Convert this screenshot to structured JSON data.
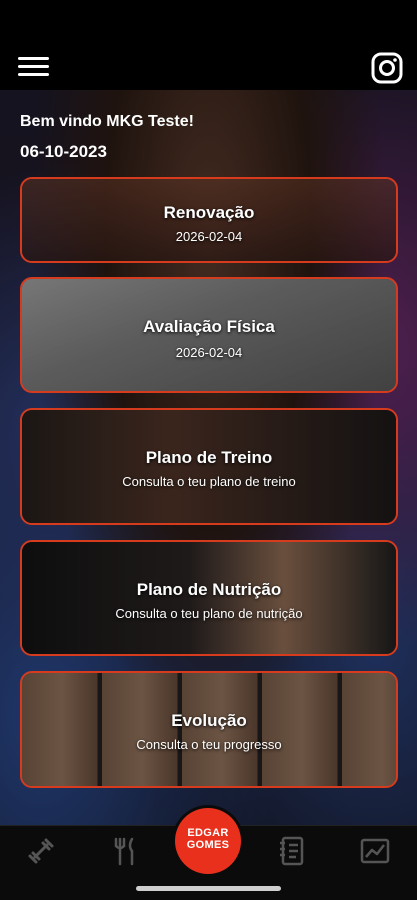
{
  "header": {
    "menu_icon": "hamburger-menu-icon",
    "instagram_icon": "instagram-icon"
  },
  "greeting": {
    "welcome": "Bem vindo MKG Teste!",
    "date": "06-10-2023"
  },
  "cards": [
    {
      "title": "Renovação",
      "subtitle": "2026-02-04"
    },
    {
      "title": "Avaliação Física",
      "subtitle": "2026-02-04"
    },
    {
      "title": "Plano de Treino",
      "subtitle": "Consulta o teu plano de treino"
    },
    {
      "title": "Plano de Nutrição",
      "subtitle": "Consulta o teu plano de nutrição"
    },
    {
      "title": "Evolução",
      "subtitle": "Consulta o teu progresso"
    }
  ],
  "bottom_nav": {
    "items": [
      "dumbbell-icon",
      "cutlery-icon",
      "notebook-icon",
      "chart-icon"
    ],
    "logo_line1": "EDGAR",
    "logo_line2": "GOMES"
  },
  "colors": {
    "accent": "#d63b1e",
    "logo": "#e8301c",
    "background": "#000000"
  }
}
